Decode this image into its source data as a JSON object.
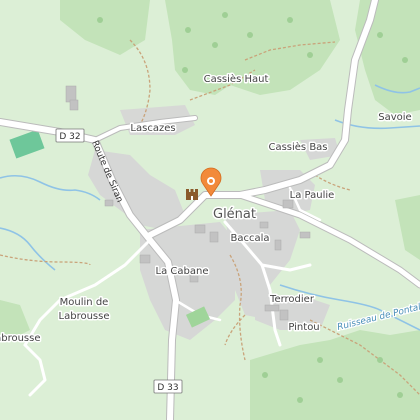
{
  "map": {
    "places": {
      "cassies_haut": "Cassiès Haut",
      "lascazes": "Lascazes",
      "cassies_bas": "Cassiès Bas",
      "savoie": "Savoie",
      "la_paulie": "La Paulie",
      "glenat": "Glénat",
      "baccala": "Baccala",
      "la_cabane": "La Cabane",
      "terrodier": "Terrodier",
      "pintou": "Pintou",
      "moulin_line1": "Moulin de",
      "moulin_line2": "Labrousse",
      "labrousse": "Labrousse"
    },
    "roads": {
      "d32": "D 32",
      "d33": "D 33",
      "route_de_siran": "Route de Siran"
    },
    "water": {
      "ruisseau": "Ruisseau de Pontal"
    },
    "colors": {
      "background": "#dcefd6",
      "forest": "#c3e3b9",
      "builtup": "#d6d6d6",
      "road": "#ffffff",
      "water": "#8fc3e6",
      "marker": "#f28a3a"
    },
    "icons": {
      "marker": "map-pin-icon",
      "castle": "castle-icon",
      "tree": "tree-icon"
    }
  }
}
